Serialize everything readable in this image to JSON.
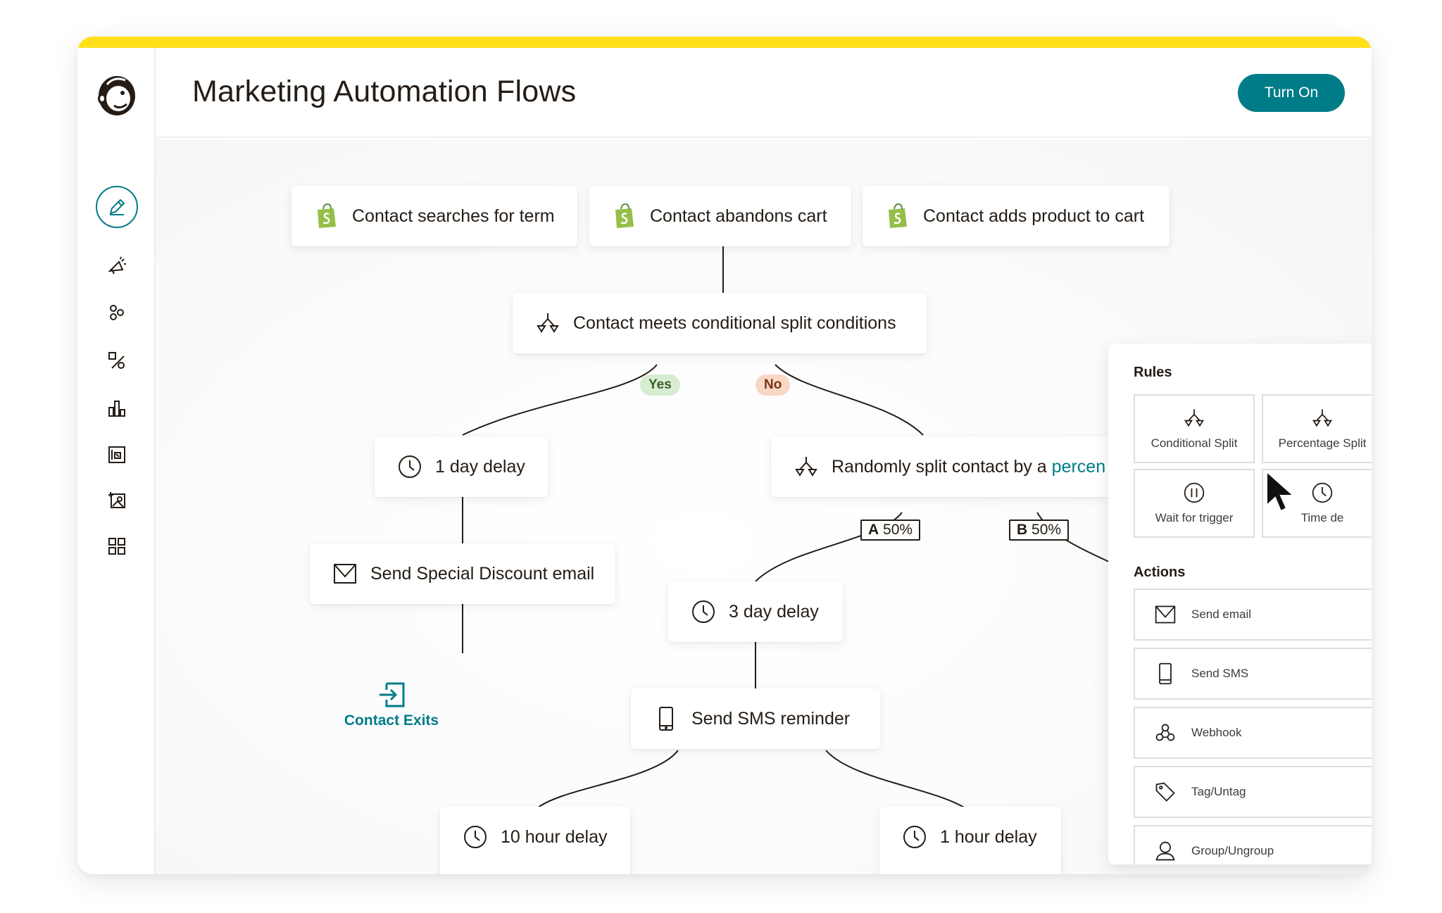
{
  "app": {
    "title": "Marketing Automation Flows",
    "turn_on_label": "Turn On",
    "brand": {
      "yellow": "#ffe01b",
      "teal": "#007c89",
      "shopify_green": "#95bf47"
    }
  },
  "sidebar": {
    "logo": "mailchimp-freddie-logo",
    "items": [
      {
        "id": "automations",
        "icon": "pencil-icon",
        "active": true
      },
      {
        "id": "campaigns",
        "icon": "megaphone-icon",
        "active": false
      },
      {
        "id": "audience",
        "icon": "audience-icon",
        "active": false
      },
      {
        "id": "segments",
        "icon": "shapes-icon",
        "active": false
      },
      {
        "id": "analytics",
        "icon": "bar-chart-icon",
        "active": false
      },
      {
        "id": "website",
        "icon": "website-icon",
        "active": false
      },
      {
        "id": "content",
        "icon": "content-icon",
        "active": false
      },
      {
        "id": "integrations",
        "icon": "grid-icon",
        "active": false
      }
    ]
  },
  "flow": {
    "triggers": [
      {
        "label": "Contact searches for term",
        "icon": "shopify-icon"
      },
      {
        "label": "Contact abandons cart",
        "icon": "shopify-icon"
      },
      {
        "label": "Contact adds product to cart",
        "icon": "shopify-icon"
      }
    ],
    "conditional_split": {
      "label": "Contact meets conditional split conditions",
      "yes_label": "Yes",
      "no_label": "No"
    },
    "one_day_delay": {
      "label": "1 day delay"
    },
    "random_split": {
      "label": "Randomly split contact by a ",
      "link": "percen",
      "a_letter": "A",
      "a_value": "50%",
      "b_letter": "B",
      "b_value": "50%"
    },
    "send_email": {
      "label": "Send Special Discount email"
    },
    "contact_exits": {
      "label": "Contact Exits"
    },
    "three_day_delay": {
      "label": "3 day delay"
    },
    "sms_reminder": {
      "label": "Send SMS reminder"
    },
    "ten_hour_delay": {
      "label": "10 hour delay"
    },
    "one_hour_delay": {
      "label": "1 hour delay"
    }
  },
  "panel": {
    "rules_heading": "Rules",
    "rules": [
      {
        "label": "Conditional Split",
        "icon": "split-icon"
      },
      {
        "label": "Percentage Split",
        "icon": "split-icon"
      },
      {
        "label": "Wait for trigger",
        "icon": "pause-icon"
      },
      {
        "label": "Time de",
        "icon": "clock-icon"
      }
    ],
    "actions_heading": "Actions",
    "actions": [
      {
        "label": "Send email",
        "icon": "envelope-icon"
      },
      {
        "label": "Send SMS",
        "icon": "phone-icon"
      },
      {
        "label": "Webhook",
        "icon": "webhook-icon"
      },
      {
        "label": "Tag/Untag",
        "icon": "tag-icon"
      },
      {
        "label": "Group/Ungroup",
        "icon": "person-icon"
      }
    ]
  }
}
